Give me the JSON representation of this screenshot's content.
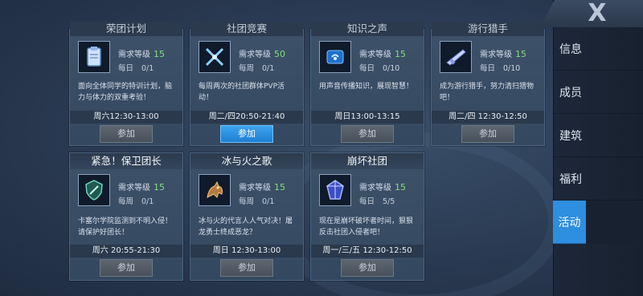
{
  "nav": {
    "close_glyph": "X",
    "items": [
      {
        "label": "信息"
      },
      {
        "label": "成员"
      },
      {
        "label": "建筑"
      },
      {
        "label": "福利"
      },
      {
        "label": "活动"
      }
    ],
    "active_index": 4
  },
  "req_label": "需求等级",
  "cards": [
    {
      "title": "荣团计划",
      "level": "15",
      "count_label": "每日",
      "count": "0/1",
      "desc": "面向全体同学的特训计划，脑力与体力的双重考验！",
      "time": "周六12:30-13:00",
      "button": "参加",
      "icon": "clipboard-icon"
    },
    {
      "title": "社团竞赛",
      "level": "50",
      "count_label": "每周",
      "count": "0/1",
      "desc": "每周两次的社团群体PVP活动！",
      "time": "周二/四20:50-21:40",
      "button": "参加",
      "icon": "crossed-swords-icon"
    },
    {
      "title": "知识之声",
      "level": "15",
      "count_label": "每日",
      "count": "0/10",
      "desc": "用声音传播知识，展现智慧！",
      "time": "周日13:00-13:15",
      "button": "参加",
      "icon": "broadcast-icon"
    },
    {
      "title": "游行猎手",
      "level": "15",
      "count_label": "每日",
      "count": "0/10",
      "desc": "成为游行猎手，努力清扫猎物吧！",
      "time": "周二/四 12:30-12:50",
      "button": "参加",
      "icon": "rifle-icon"
    },
    {
      "title": "紧急！保卫团长",
      "level": "15",
      "count_label": "每周",
      "count": "0/1",
      "desc": "卡塞尔学院监测到不明入侵！请保护好团长！",
      "time": "周六 20:55-21:30",
      "button": "参加",
      "icon": "shield-emblem-icon"
    },
    {
      "title": "冰与火之歌",
      "level": "15",
      "count_label": "每周",
      "count": "0/1",
      "desc": "冰与火的代言人人气对决！屠龙勇士终成恶龙？",
      "time": "周日 12:30-13:00",
      "button": "参加",
      "icon": "dragon-icon"
    },
    {
      "title": "崩坏社团",
      "level": "15",
      "count_label": "每日",
      "count": "5/5",
      "desc": "现在是崩坏破坏者时间，狠狠反击社团入侵者吧！",
      "time": "周一/三/五 12:30-12:50",
      "button": "参加",
      "icon": "broken-crystal-icon"
    }
  ],
  "colors": {
    "accent": "#2e8ee0",
    "level_green": "#7fe07a"
  }
}
